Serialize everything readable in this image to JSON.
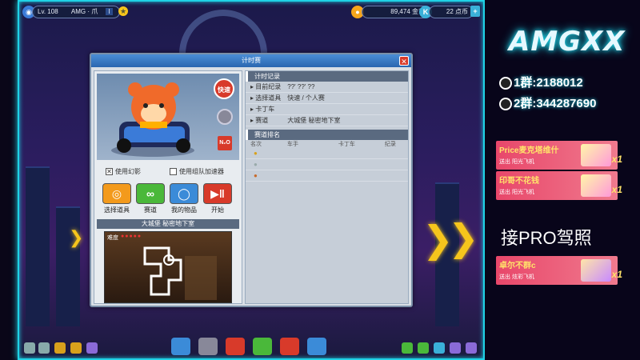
{
  "topbar": {
    "level": "Lv. 108",
    "player_name": "AMG · 爪",
    "player_tag": "I",
    "coins": "89,474 金币",
    "points": "22 点币"
  },
  "dialog": {
    "title": "计时赛",
    "close_label": "✕",
    "quick_button": "快速",
    "nitro_button": "N₂O",
    "option_ghost": "使用幻影",
    "option_team_boost": "使用组队加速器",
    "actions": [
      {
        "label": "选择道具",
        "icon": "target-icon"
      },
      {
        "label": "赛道",
        "icon": "track-icon"
      },
      {
        "label": "我的物品",
        "icon": "items-icon"
      },
      {
        "label": "开始",
        "icon": "start-icon"
      }
    ],
    "map_title": "大城堡  秘密地下室",
    "map_difficulty_label": "难度",
    "record_section": "计时记录",
    "records": [
      {
        "key": "目前纪录",
        "value": "??' ??' ??"
      },
      {
        "key": "选择道具",
        "value": "快速 / 个人赛"
      },
      {
        "key": "卡丁车",
        "value": ""
      },
      {
        "key": "赛道",
        "value": "大城堡  秘密地下室"
      }
    ],
    "ranking_section": "赛道排名",
    "ranking_columns": [
      "名次",
      "车手",
      "卡丁车",
      "纪录"
    ]
  },
  "side": {
    "brand": "AMGXX",
    "qq1": "1群:2188012",
    "qq2": "2群:344287690",
    "gifts": [
      {
        "name": "Price麦克塔维什",
        "sub": "送出   阳光飞机",
        "count": "x1"
      },
      {
        "name": "印哥不花钱",
        "sub": "送出   阳光飞机",
        "count": "x1"
      },
      {
        "name": "卓尔不群c",
        "sub": "送出   炫彩飞机",
        "count": "x1"
      }
    ],
    "pro_text": "接PRO驾照"
  },
  "colors": {
    "frame": "#1fd3e6",
    "gift_bg": "#e8476a",
    "accent_yellow": "#f6c51c"
  }
}
